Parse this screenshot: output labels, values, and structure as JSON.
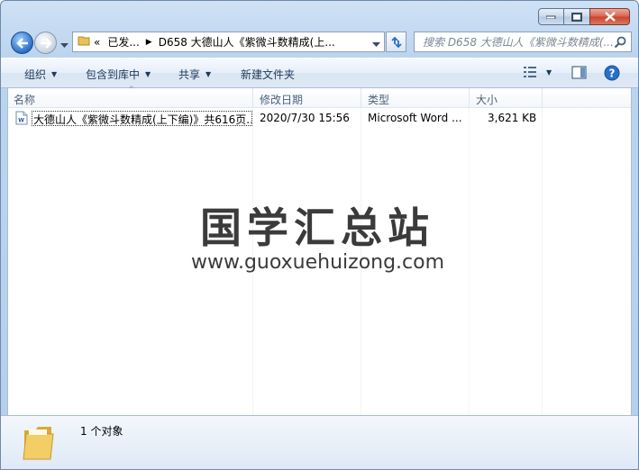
{
  "window": {
    "caption_buttons": [
      "minimize",
      "maximize",
      "close"
    ]
  },
  "nav": {
    "address": {
      "overflow_label": "«",
      "crumb1": "已发...",
      "crumb2": "D658 大德山人《紫微斗数精成(上..."
    },
    "search_placeholder": "搜索 D658 大德山人《紫微斗数精成(..."
  },
  "toolbar": {
    "organize": "组织",
    "include_in_library": "包含到库中",
    "share": "共享",
    "new_folder": "新建文件夹"
  },
  "columns": {
    "name": "名称",
    "date": "修改日期",
    "type": "类型",
    "size": "大小"
  },
  "files": [
    {
      "name": "大德山人《紫微斗数精成(上下编)》共616页...",
      "date": "2020/7/30 15:56",
      "type": "Microsoft Word ...",
      "size": "3,621 KB",
      "icon": "word-doc-icon"
    }
  ],
  "watermark": {
    "title": "国学汇总站",
    "url": "www.guoxuehuizong.com"
  },
  "status": {
    "count_text": "1 个对象"
  },
  "colors": {
    "accent": "#2a6fc6",
    "header_text": "#4c607a"
  }
}
